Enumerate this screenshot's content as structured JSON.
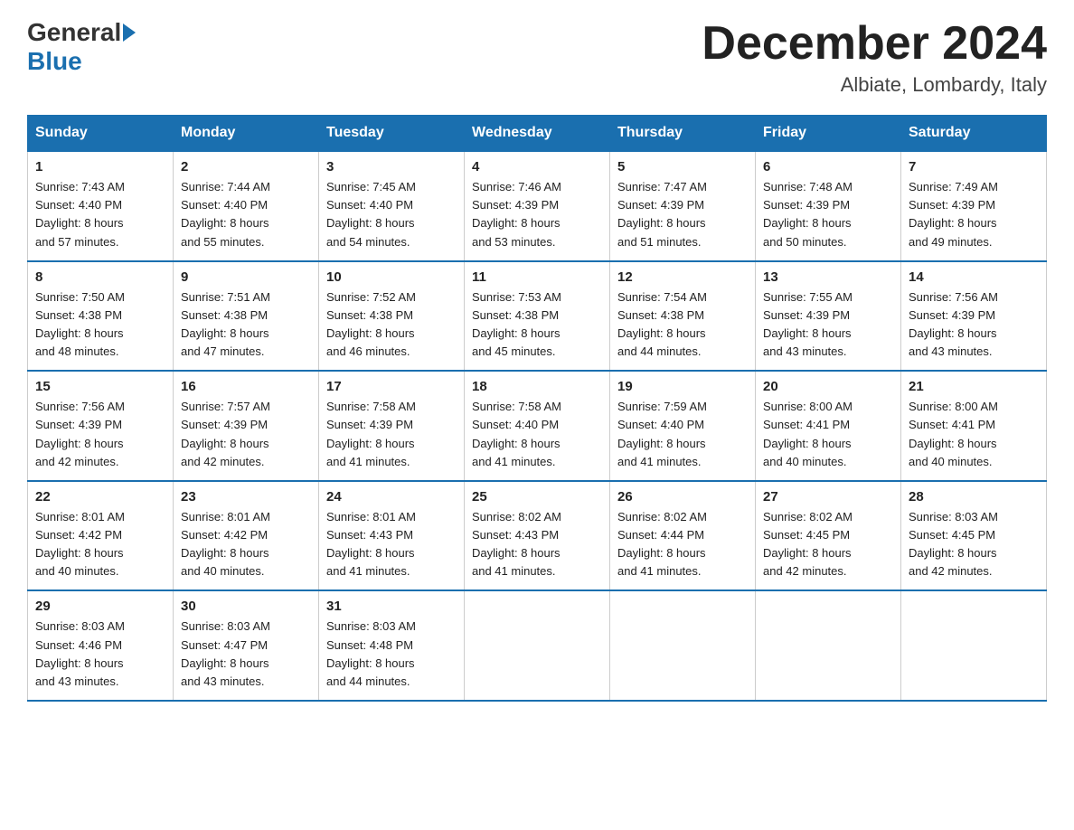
{
  "logo": {
    "general": "General",
    "blue": "Blue"
  },
  "title": "December 2024",
  "location": "Albiate, Lombardy, Italy",
  "days_of_week": [
    "Sunday",
    "Monday",
    "Tuesday",
    "Wednesday",
    "Thursday",
    "Friday",
    "Saturday"
  ],
  "weeks": [
    [
      {
        "day": "1",
        "sunrise": "7:43 AM",
        "sunset": "4:40 PM",
        "daylight": "8 hours and 57 minutes."
      },
      {
        "day": "2",
        "sunrise": "7:44 AM",
        "sunset": "4:40 PM",
        "daylight": "8 hours and 55 minutes."
      },
      {
        "day": "3",
        "sunrise": "7:45 AM",
        "sunset": "4:40 PM",
        "daylight": "8 hours and 54 minutes."
      },
      {
        "day": "4",
        "sunrise": "7:46 AM",
        "sunset": "4:39 PM",
        "daylight": "8 hours and 53 minutes."
      },
      {
        "day": "5",
        "sunrise": "7:47 AM",
        "sunset": "4:39 PM",
        "daylight": "8 hours and 51 minutes."
      },
      {
        "day": "6",
        "sunrise": "7:48 AM",
        "sunset": "4:39 PM",
        "daylight": "8 hours and 50 minutes."
      },
      {
        "day": "7",
        "sunrise": "7:49 AM",
        "sunset": "4:39 PM",
        "daylight": "8 hours and 49 minutes."
      }
    ],
    [
      {
        "day": "8",
        "sunrise": "7:50 AM",
        "sunset": "4:38 PM",
        "daylight": "8 hours and 48 minutes."
      },
      {
        "day": "9",
        "sunrise": "7:51 AM",
        "sunset": "4:38 PM",
        "daylight": "8 hours and 47 minutes."
      },
      {
        "day": "10",
        "sunrise": "7:52 AM",
        "sunset": "4:38 PM",
        "daylight": "8 hours and 46 minutes."
      },
      {
        "day": "11",
        "sunrise": "7:53 AM",
        "sunset": "4:38 PM",
        "daylight": "8 hours and 45 minutes."
      },
      {
        "day": "12",
        "sunrise": "7:54 AM",
        "sunset": "4:38 PM",
        "daylight": "8 hours and 44 minutes."
      },
      {
        "day": "13",
        "sunrise": "7:55 AM",
        "sunset": "4:39 PM",
        "daylight": "8 hours and 43 minutes."
      },
      {
        "day": "14",
        "sunrise": "7:56 AM",
        "sunset": "4:39 PM",
        "daylight": "8 hours and 43 minutes."
      }
    ],
    [
      {
        "day": "15",
        "sunrise": "7:56 AM",
        "sunset": "4:39 PM",
        "daylight": "8 hours and 42 minutes."
      },
      {
        "day": "16",
        "sunrise": "7:57 AM",
        "sunset": "4:39 PM",
        "daylight": "8 hours and 42 minutes."
      },
      {
        "day": "17",
        "sunrise": "7:58 AM",
        "sunset": "4:39 PM",
        "daylight": "8 hours and 41 minutes."
      },
      {
        "day": "18",
        "sunrise": "7:58 AM",
        "sunset": "4:40 PM",
        "daylight": "8 hours and 41 minutes."
      },
      {
        "day": "19",
        "sunrise": "7:59 AM",
        "sunset": "4:40 PM",
        "daylight": "8 hours and 41 minutes."
      },
      {
        "day": "20",
        "sunrise": "8:00 AM",
        "sunset": "4:41 PM",
        "daylight": "8 hours and 40 minutes."
      },
      {
        "day": "21",
        "sunrise": "8:00 AM",
        "sunset": "4:41 PM",
        "daylight": "8 hours and 40 minutes."
      }
    ],
    [
      {
        "day": "22",
        "sunrise": "8:01 AM",
        "sunset": "4:42 PM",
        "daylight": "8 hours and 40 minutes."
      },
      {
        "day": "23",
        "sunrise": "8:01 AM",
        "sunset": "4:42 PM",
        "daylight": "8 hours and 40 minutes."
      },
      {
        "day": "24",
        "sunrise": "8:01 AM",
        "sunset": "4:43 PM",
        "daylight": "8 hours and 41 minutes."
      },
      {
        "day": "25",
        "sunrise": "8:02 AM",
        "sunset": "4:43 PM",
        "daylight": "8 hours and 41 minutes."
      },
      {
        "day": "26",
        "sunrise": "8:02 AM",
        "sunset": "4:44 PM",
        "daylight": "8 hours and 41 minutes."
      },
      {
        "day": "27",
        "sunrise": "8:02 AM",
        "sunset": "4:45 PM",
        "daylight": "8 hours and 42 minutes."
      },
      {
        "day": "28",
        "sunrise": "8:03 AM",
        "sunset": "4:45 PM",
        "daylight": "8 hours and 42 minutes."
      }
    ],
    [
      {
        "day": "29",
        "sunrise": "8:03 AM",
        "sunset": "4:46 PM",
        "daylight": "8 hours and 43 minutes."
      },
      {
        "day": "30",
        "sunrise": "8:03 AM",
        "sunset": "4:47 PM",
        "daylight": "8 hours and 43 minutes."
      },
      {
        "day": "31",
        "sunrise": "8:03 AM",
        "sunset": "4:48 PM",
        "daylight": "8 hours and 44 minutes."
      },
      null,
      null,
      null,
      null
    ]
  ],
  "labels": {
    "sunrise_prefix": "Sunrise: ",
    "sunset_prefix": "Sunset: ",
    "daylight_prefix": "Daylight: "
  }
}
